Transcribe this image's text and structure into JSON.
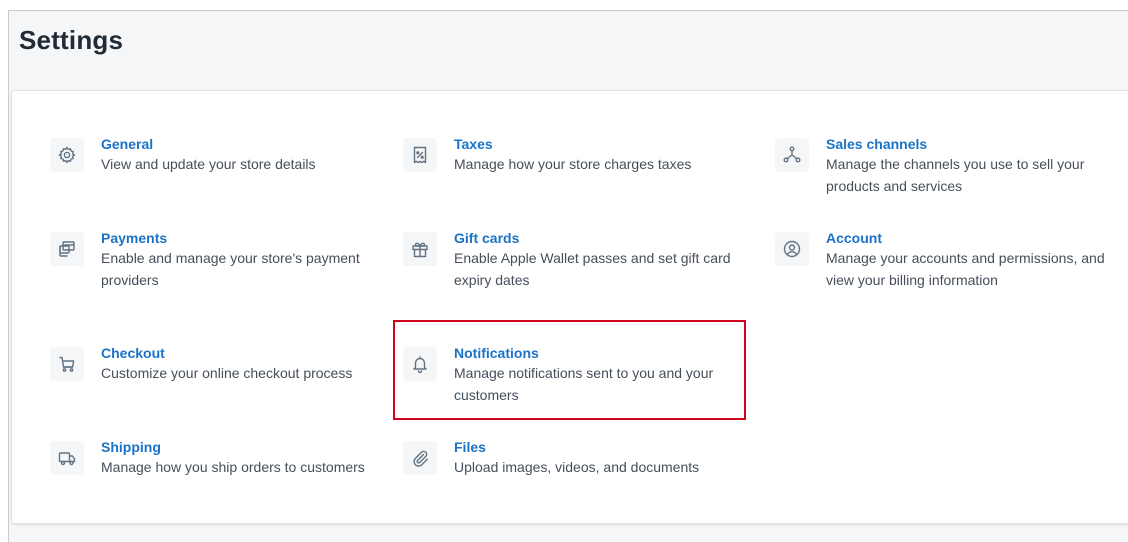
{
  "page": {
    "title": "Settings"
  },
  "settings": [
    {
      "id": "general",
      "icon": "gear-icon",
      "title": "General",
      "description": "View and update your store details"
    },
    {
      "id": "taxes",
      "icon": "receipt-percent-icon",
      "title": "Taxes",
      "description": "Manage how your store charges taxes"
    },
    {
      "id": "sales-channels",
      "icon": "network-nodes-icon",
      "title": "Sales channels",
      "description": "Manage the channels you use to sell your products and services"
    },
    {
      "id": "payments",
      "icon": "credit-card-stack-icon",
      "title": "Payments",
      "description": "Enable and manage your store's payment providers"
    },
    {
      "id": "gift-cards",
      "icon": "gift-icon",
      "title": "Gift cards",
      "description": "Enable Apple Wallet passes and set gift card expiry dates"
    },
    {
      "id": "account",
      "icon": "user-circle-icon",
      "title": "Account",
      "description": "Manage your accounts and permissions, and view your billing information"
    },
    {
      "id": "checkout",
      "icon": "cart-icon",
      "title": "Checkout",
      "description": "Customize your online checkout process"
    },
    {
      "id": "notifications",
      "icon": "bell-icon",
      "title": "Notifications",
      "description": "Manage notifications sent to you and your customers"
    },
    {
      "id": "shipping",
      "icon": "truck-icon",
      "title": "Shipping",
      "description": "Manage how you ship orders to customers"
    },
    {
      "id": "files",
      "icon": "paperclip-icon",
      "title": "Files",
      "description": "Upload images, videos, and documents"
    }
  ],
  "highlighted_item": "notifications",
  "colors": {
    "link": "#1a73c8",
    "text": "#454f5b",
    "icon": "#637381",
    "highlight": "#d0021b",
    "background": "#f4f6f8"
  }
}
